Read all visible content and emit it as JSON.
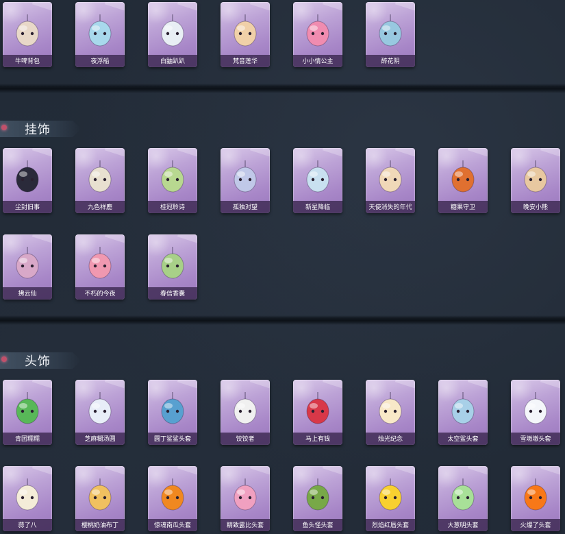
{
  "sections": [
    {
      "title": "",
      "items": [
        {
          "label": "牛啤背包",
          "icon": "cow-backpack-icon",
          "color": "#e8d8c8"
        },
        {
          "label": "夜浮船",
          "icon": "jellyfish-boat-icon",
          "color": "#a8d8ec"
        },
        {
          "label": "白鼬趴趴",
          "icon": "white-weasel-icon",
          "color": "#e8eef4"
        },
        {
          "label": "梵音莲华",
          "icon": "lotus-doll-icon",
          "color": "#f0d0a8"
        },
        {
          "label": "小小情公主",
          "icon": "pink-princess-icon",
          "color": "#f08cb0"
        },
        {
          "label": "醉花阴",
          "icon": "flower-lantern-icon",
          "color": "#98c8e0"
        }
      ]
    },
    {
      "title": "挂饰",
      "items": [
        {
          "label": "尘封旧事",
          "icon": "dark-doll-charm-icon",
          "color": "#2a2a3a"
        },
        {
          "label": "九色祥鹿",
          "icon": "deer-charm-icon",
          "color": "#e8e0d0"
        },
        {
          "label": "桂冠聆诗",
          "icon": "laurel-charm-icon",
          "color": "#b8d890"
        },
        {
          "label": "孤独对望",
          "icon": "lonely-gaze-charm-icon",
          "color": "#c0c8e8"
        },
        {
          "label": "新星降临",
          "icon": "new-star-charm-icon",
          "color": "#c8e0f0"
        },
        {
          "label": "天使消失的年代",
          "icon": "angel-charm-icon",
          "color": "#f0d8b8"
        },
        {
          "label": "糖果守卫",
          "icon": "candy-guard-charm-icon",
          "color": "#e07030"
        },
        {
          "label": "晚安小熊",
          "icon": "bear-charm-icon",
          "color": "#e8c8a0"
        },
        {
          "label": "拂云仙",
          "icon": "cloud-fairy-charm-icon",
          "color": "#d8a8c8"
        },
        {
          "label": "不朽的今夜",
          "icon": "immortal-night-charm-icon",
          "color": "#f098b0"
        },
        {
          "label": "春信香囊",
          "icon": "sachet-charm-icon",
          "color": "#a8d088"
        }
      ]
    },
    {
      "title": "头饰",
      "items": [
        {
          "label": "青团糯糯",
          "icon": "green-dumpling-head-icon",
          "color": "#58b858"
        },
        {
          "label": "芝麻糊汤圆",
          "icon": "tangyuan-head-icon",
          "color": "#e8eef8"
        },
        {
          "label": "圆丁鲨鲨头套",
          "icon": "shark-head-icon",
          "color": "#58a0d0"
        },
        {
          "label": "饺饺者",
          "icon": "dumpling-head-icon",
          "color": "#f0f0f0"
        },
        {
          "label": "马上有钱",
          "icon": "red-horse-head-icon",
          "color": "#d83848"
        },
        {
          "label": "烛光纪念",
          "icon": "candle-head-icon",
          "color": "#f8e8c8"
        },
        {
          "label": "太空鲨头套",
          "icon": "space-shark-head-icon",
          "color": "#a8d0e8"
        },
        {
          "label": "雪墩墩头套",
          "icon": "snowman-head-icon",
          "color": "#f4f6fa"
        },
        {
          "label": "蒜了八",
          "icon": "garlic-head-icon",
          "color": "#f4ecd8"
        },
        {
          "label": "樱桃奶油布丁",
          "icon": "pudding-head-icon",
          "color": "#f0c060"
        },
        {
          "label": "惊魂南瓜头套",
          "icon": "pumpkin-head-icon",
          "color": "#f08820"
        },
        {
          "label": "精致露比头套",
          "icon": "pink-pig-head-icon",
          "color": "#f0a0c0"
        },
        {
          "label": "鱼头怪头套",
          "icon": "fish-head-icon",
          "color": "#78a848"
        },
        {
          "label": "烈焰红唇头套",
          "icon": "pikachu-head-icon",
          "color": "#f8d030"
        },
        {
          "label": "大葱明头套",
          "icon": "scallion-head-icon",
          "color": "#a8e098"
        },
        {
          "label": "火爆了头套",
          "icon": "fire-head-icon",
          "color": "#f87818"
        }
      ]
    }
  ]
}
